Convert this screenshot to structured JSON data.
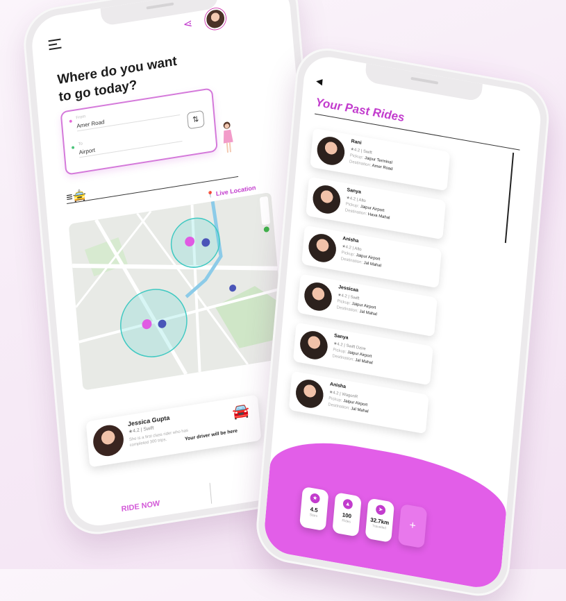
{
  "left_phone": {
    "question_line1": "Where do you want",
    "question_line2": "to go today?",
    "from_label": "From",
    "from_value": "Amer Road",
    "to_label": "To",
    "to_value": "Airport",
    "live_location": "Live Location",
    "driver": {
      "name": "Jessica Gupta",
      "rating_car": "★4.2  |  Swift",
      "description": "She is a first class rider who has completed 300 trips.",
      "arrival": "Your driver will be here"
    },
    "ride_now": "RIDE NOW"
  },
  "right_phone": {
    "title": "Your Past Rides",
    "rides": [
      {
        "name": "Rani",
        "meta": "★4.2  |  Swift",
        "pickup": "Jaipur Terminal",
        "destination": "Amer Road"
      },
      {
        "name": "Sanya",
        "meta": "★4.2  |  Alto",
        "pickup": "Jaipur Airport",
        "destination": "Hava Mahal"
      },
      {
        "name": "Anisha",
        "meta": "★4.2  |  Alto",
        "pickup": "Jaipur Airport",
        "destination": "Jal Mahal"
      },
      {
        "name": "Jessicaa",
        "meta": "★4.2  |  Swift",
        "pickup": "Jaipur Airport",
        "destination": "Jal Mahal"
      },
      {
        "name": "Sanya",
        "meta": "★4.2  |  Swift Dzire",
        "pickup": "Jaipur Airport",
        "destination": "Jal Mahal"
      },
      {
        "name": "Anisha",
        "meta": "★4.2  |  WagonR",
        "pickup": "Jaipur Airport",
        "destination": "Jal Mahal"
      }
    ],
    "pickup_label": "Pickup:",
    "destination_label": "Destination:",
    "stats": [
      {
        "value": "4.5",
        "label": "Stars"
      },
      {
        "value": "100",
        "label": "Rides"
      },
      {
        "value": "32.7km",
        "label": "Travelled"
      }
    ],
    "add_symbol": "+"
  },
  "colors": {
    "accent": "#c23ccd",
    "bottom_panel": "#e25ee8",
    "card_border": "#d479da"
  },
  "icons": [
    "hamburger-icon",
    "share-icon",
    "swap-icon",
    "car-icon",
    "location-pin-icon",
    "back-arrow-icon",
    "star-icon",
    "plus-icon"
  ]
}
